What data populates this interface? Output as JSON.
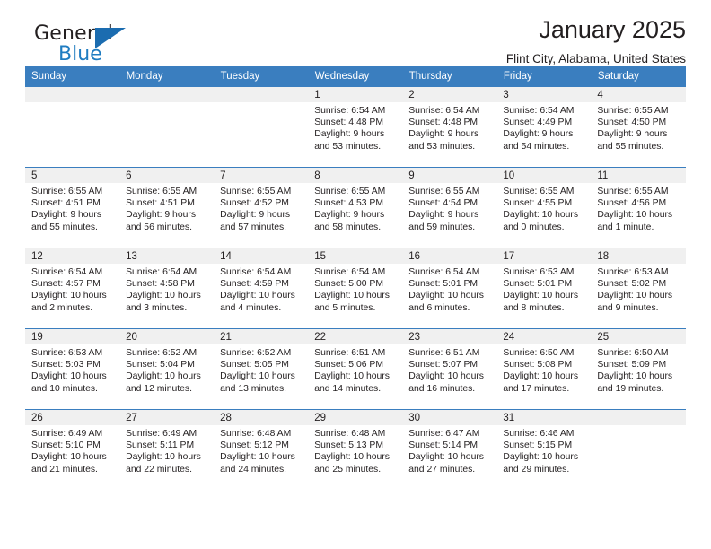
{
  "brand": {
    "word1": "General",
    "word2": "Blue",
    "logo_icon": "triangle-logo-icon",
    "accent_color": "#1b6cb0"
  },
  "header": {
    "title": "January 2025",
    "subtitle": "Flint City, Alabama, United States"
  },
  "calendar": {
    "header_bg": "#3a7ebf",
    "daynum_bg": "#f0f0f0",
    "weekdays": [
      "Sunday",
      "Monday",
      "Tuesday",
      "Wednesday",
      "Thursday",
      "Friday",
      "Saturday"
    ],
    "weeks": [
      [
        {
          "day": "",
          "sunrise": "",
          "sunset": "",
          "daylight1": "",
          "daylight2": ""
        },
        {
          "day": "",
          "sunrise": "",
          "sunset": "",
          "daylight1": "",
          "daylight2": ""
        },
        {
          "day": "",
          "sunrise": "",
          "sunset": "",
          "daylight1": "",
          "daylight2": ""
        },
        {
          "day": "1",
          "sunrise": "Sunrise: 6:54 AM",
          "sunset": "Sunset: 4:48 PM",
          "daylight1": "Daylight: 9 hours",
          "daylight2": "and 53 minutes."
        },
        {
          "day": "2",
          "sunrise": "Sunrise: 6:54 AM",
          "sunset": "Sunset: 4:48 PM",
          "daylight1": "Daylight: 9 hours",
          "daylight2": "and 53 minutes."
        },
        {
          "day": "3",
          "sunrise": "Sunrise: 6:54 AM",
          "sunset": "Sunset: 4:49 PM",
          "daylight1": "Daylight: 9 hours",
          "daylight2": "and 54 minutes."
        },
        {
          "day": "4",
          "sunrise": "Sunrise: 6:55 AM",
          "sunset": "Sunset: 4:50 PM",
          "daylight1": "Daylight: 9 hours",
          "daylight2": "and 55 minutes."
        }
      ],
      [
        {
          "day": "5",
          "sunrise": "Sunrise: 6:55 AM",
          "sunset": "Sunset: 4:51 PM",
          "daylight1": "Daylight: 9 hours",
          "daylight2": "and 55 minutes."
        },
        {
          "day": "6",
          "sunrise": "Sunrise: 6:55 AM",
          "sunset": "Sunset: 4:51 PM",
          "daylight1": "Daylight: 9 hours",
          "daylight2": "and 56 minutes."
        },
        {
          "day": "7",
          "sunrise": "Sunrise: 6:55 AM",
          "sunset": "Sunset: 4:52 PM",
          "daylight1": "Daylight: 9 hours",
          "daylight2": "and 57 minutes."
        },
        {
          "day": "8",
          "sunrise": "Sunrise: 6:55 AM",
          "sunset": "Sunset: 4:53 PM",
          "daylight1": "Daylight: 9 hours",
          "daylight2": "and 58 minutes."
        },
        {
          "day": "9",
          "sunrise": "Sunrise: 6:55 AM",
          "sunset": "Sunset: 4:54 PM",
          "daylight1": "Daylight: 9 hours",
          "daylight2": "and 59 minutes."
        },
        {
          "day": "10",
          "sunrise": "Sunrise: 6:55 AM",
          "sunset": "Sunset: 4:55 PM",
          "daylight1": "Daylight: 10 hours",
          "daylight2": "and 0 minutes."
        },
        {
          "day": "11",
          "sunrise": "Sunrise: 6:55 AM",
          "sunset": "Sunset: 4:56 PM",
          "daylight1": "Daylight: 10 hours",
          "daylight2": "and 1 minute."
        }
      ],
      [
        {
          "day": "12",
          "sunrise": "Sunrise: 6:54 AM",
          "sunset": "Sunset: 4:57 PM",
          "daylight1": "Daylight: 10 hours",
          "daylight2": "and 2 minutes."
        },
        {
          "day": "13",
          "sunrise": "Sunrise: 6:54 AM",
          "sunset": "Sunset: 4:58 PM",
          "daylight1": "Daylight: 10 hours",
          "daylight2": "and 3 minutes."
        },
        {
          "day": "14",
          "sunrise": "Sunrise: 6:54 AM",
          "sunset": "Sunset: 4:59 PM",
          "daylight1": "Daylight: 10 hours",
          "daylight2": "and 4 minutes."
        },
        {
          "day": "15",
          "sunrise": "Sunrise: 6:54 AM",
          "sunset": "Sunset: 5:00 PM",
          "daylight1": "Daylight: 10 hours",
          "daylight2": "and 5 minutes."
        },
        {
          "day": "16",
          "sunrise": "Sunrise: 6:54 AM",
          "sunset": "Sunset: 5:01 PM",
          "daylight1": "Daylight: 10 hours",
          "daylight2": "and 6 minutes."
        },
        {
          "day": "17",
          "sunrise": "Sunrise: 6:53 AM",
          "sunset": "Sunset: 5:01 PM",
          "daylight1": "Daylight: 10 hours",
          "daylight2": "and 8 minutes."
        },
        {
          "day": "18",
          "sunrise": "Sunrise: 6:53 AM",
          "sunset": "Sunset: 5:02 PM",
          "daylight1": "Daylight: 10 hours",
          "daylight2": "and 9 minutes."
        }
      ],
      [
        {
          "day": "19",
          "sunrise": "Sunrise: 6:53 AM",
          "sunset": "Sunset: 5:03 PM",
          "daylight1": "Daylight: 10 hours",
          "daylight2": "and 10 minutes."
        },
        {
          "day": "20",
          "sunrise": "Sunrise: 6:52 AM",
          "sunset": "Sunset: 5:04 PM",
          "daylight1": "Daylight: 10 hours",
          "daylight2": "and 12 minutes."
        },
        {
          "day": "21",
          "sunrise": "Sunrise: 6:52 AM",
          "sunset": "Sunset: 5:05 PM",
          "daylight1": "Daylight: 10 hours",
          "daylight2": "and 13 minutes."
        },
        {
          "day": "22",
          "sunrise": "Sunrise: 6:51 AM",
          "sunset": "Sunset: 5:06 PM",
          "daylight1": "Daylight: 10 hours",
          "daylight2": "and 14 minutes."
        },
        {
          "day": "23",
          "sunrise": "Sunrise: 6:51 AM",
          "sunset": "Sunset: 5:07 PM",
          "daylight1": "Daylight: 10 hours",
          "daylight2": "and 16 minutes."
        },
        {
          "day": "24",
          "sunrise": "Sunrise: 6:50 AM",
          "sunset": "Sunset: 5:08 PM",
          "daylight1": "Daylight: 10 hours",
          "daylight2": "and 17 minutes."
        },
        {
          "day": "25",
          "sunrise": "Sunrise: 6:50 AM",
          "sunset": "Sunset: 5:09 PM",
          "daylight1": "Daylight: 10 hours",
          "daylight2": "and 19 minutes."
        }
      ],
      [
        {
          "day": "26",
          "sunrise": "Sunrise: 6:49 AM",
          "sunset": "Sunset: 5:10 PM",
          "daylight1": "Daylight: 10 hours",
          "daylight2": "and 21 minutes."
        },
        {
          "day": "27",
          "sunrise": "Sunrise: 6:49 AM",
          "sunset": "Sunset: 5:11 PM",
          "daylight1": "Daylight: 10 hours",
          "daylight2": "and 22 minutes."
        },
        {
          "day": "28",
          "sunrise": "Sunrise: 6:48 AM",
          "sunset": "Sunset: 5:12 PM",
          "daylight1": "Daylight: 10 hours",
          "daylight2": "and 24 minutes."
        },
        {
          "day": "29",
          "sunrise": "Sunrise: 6:48 AM",
          "sunset": "Sunset: 5:13 PM",
          "daylight1": "Daylight: 10 hours",
          "daylight2": "and 25 minutes."
        },
        {
          "day": "30",
          "sunrise": "Sunrise: 6:47 AM",
          "sunset": "Sunset: 5:14 PM",
          "daylight1": "Daylight: 10 hours",
          "daylight2": "and 27 minutes."
        },
        {
          "day": "31",
          "sunrise": "Sunrise: 6:46 AM",
          "sunset": "Sunset: 5:15 PM",
          "daylight1": "Daylight: 10 hours",
          "daylight2": "and 29 minutes."
        },
        {
          "day": "",
          "sunrise": "",
          "sunset": "",
          "daylight1": "",
          "daylight2": ""
        }
      ]
    ]
  }
}
